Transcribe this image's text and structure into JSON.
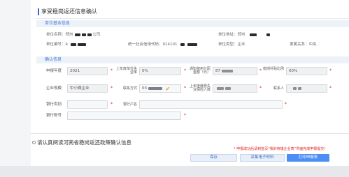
{
  "window": {
    "title": "享受稳岗返还信息确认"
  },
  "basic_info": {
    "section_title": "单位基本信息",
    "unit_name": {
      "label": "单位名称：",
      "value_start": "郑州",
      "value_end": "公司"
    },
    "unit_address": {
      "label": "单位地址：",
      "value_start": "郑州"
    },
    "unit_code": {
      "label": "单位编号：",
      "value_start": "4"
    },
    "credit_code": {
      "label": "统一社会信用代码：",
      "value_start": "914101"
    },
    "unit_type": {
      "label": "单位类型：",
      "value": "企业"
    },
    "affiliation": {
      "label": "隶属关系：",
      "value": "中央"
    }
  },
  "confirm_info": {
    "section_title": "确认信息",
    "required_mark": "*",
    "declare_year": {
      "label": "申报年度",
      "value": "2021"
    },
    "unemployment_rate": {
      "label": "上年度单位失业率",
      "value": "0%"
    },
    "allocated_amount": {
      "label": "通知使用分配金额（元）",
      "value_start": "87"
    },
    "subsidy_ratio": {
      "label": "稳岗补贴比例",
      "value": "60%"
    },
    "enterprise_scale": {
      "label": "企业规模",
      "value": "中小微企业"
    },
    "contact_method": {
      "label": "联系方式",
      "value_start": "03"
    },
    "insured_count": {
      "label": "上年度缴费失业保险人数"
    },
    "contact_person": {
      "label": "联系人"
    },
    "bank_type": {
      "label": "银行类别"
    },
    "bank_account_name": {
      "label": "银行户名"
    },
    "bank_account_number": {
      "label": "银行账号"
    }
  },
  "agreement": {
    "text": "请认真阅读河南省稳岗返还政策确认信息",
    "checked": false
  },
  "notice": {
    "text": "* 申报成功后请到首页“我的待填企业表”界面完成申报提交!"
  },
  "actions": {
    "save_label": "保存",
    "collect_label": "采集电子材料",
    "print_label": "打印申报表"
  },
  "colors": {
    "accent": "#3c78d8",
    "primary_button": "#4c8df6",
    "required": "#e02020",
    "edit_icon": "#e6a23c"
  }
}
